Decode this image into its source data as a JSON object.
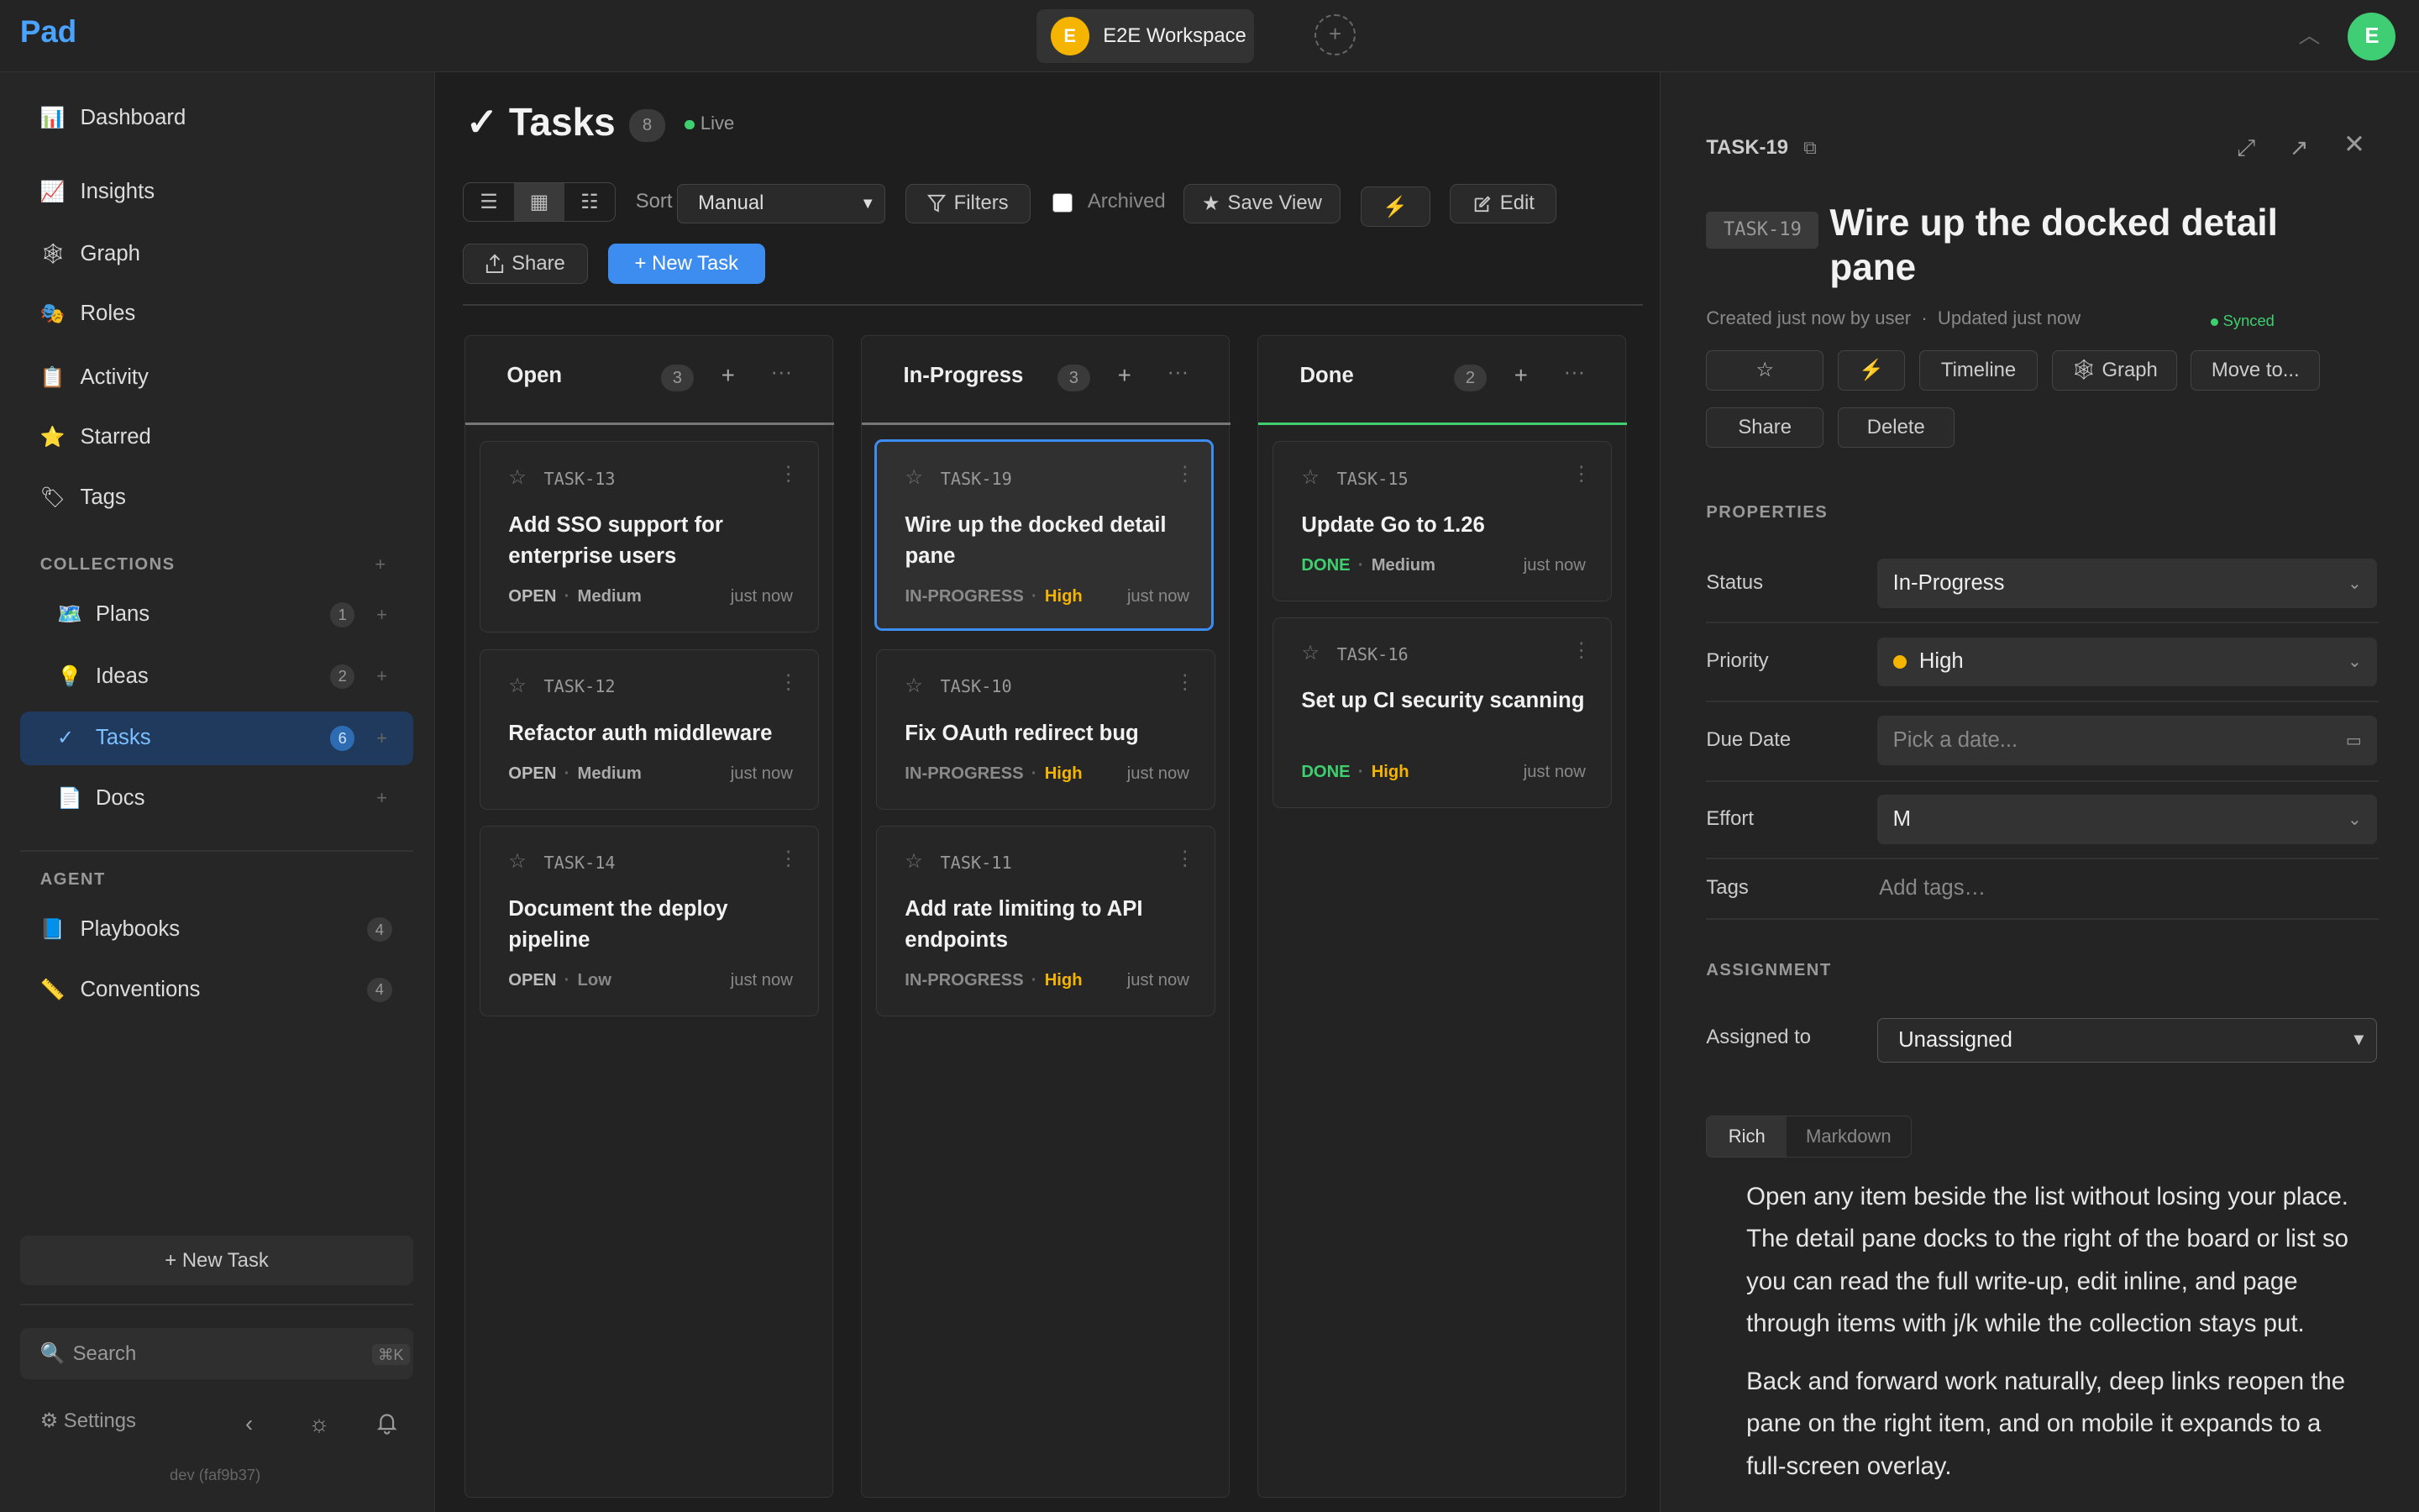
{
  "app": {
    "logo": "Pad"
  },
  "workspace": {
    "initial": "E",
    "name": "E2E Workspace",
    "add": "+"
  },
  "user": {
    "initial": "E"
  },
  "sidebar": {
    "nav": [
      {
        "icon": "📊",
        "label": "Dashboard"
      },
      {
        "icon": "📈",
        "label": "Insights"
      },
      {
        "icon": "🕸",
        "label": "Graph"
      },
      {
        "icon": "🎭",
        "label": "Roles"
      },
      {
        "icon": "📋",
        "label": "Activity"
      },
      {
        "icon": "⭐",
        "label": "Starred"
      },
      {
        "icon": "🏷",
        "label": "Tags"
      }
    ],
    "collections_heading": "COLLECTIONS",
    "collections": [
      {
        "icon": "🗺️",
        "label": "Plans",
        "count": "1"
      },
      {
        "icon": "💡",
        "label": "Ideas",
        "count": "2"
      },
      {
        "icon": "✓",
        "label": "Tasks",
        "count": "6"
      },
      {
        "icon": "📄",
        "label": "Docs",
        "count": ""
      }
    ],
    "agent_heading": "AGENT",
    "agent": [
      {
        "icon": "📘",
        "label": "Playbooks",
        "count": "4"
      },
      {
        "icon": "📏",
        "label": "Conventions",
        "count": "4"
      }
    ],
    "new_task": "+ New Task",
    "search_placeholder": "Search",
    "search_shortcut": "⌘K",
    "settings": "Settings",
    "version": "dev (faf9b37)"
  },
  "main": {
    "title": "Tasks",
    "title_icon": "✓",
    "count": "8",
    "live": "Live",
    "sort_label": "Sort",
    "sort_value": "Manual",
    "filters": "Filters",
    "archived": "Archived",
    "save_view": "Save View",
    "edit": "Edit",
    "share": "Share",
    "new_task": "+ New Task"
  },
  "board": {
    "columns": [
      {
        "title": "Open",
        "count": "3",
        "accent": "#777777",
        "cards": [
          {
            "id": "TASK-13",
            "title": "Add SSO support for enterprise users",
            "status": "OPEN",
            "priority": "Medium",
            "time": "just now"
          },
          {
            "id": "TASK-12",
            "title": "Refactor auth middleware",
            "status": "OPEN",
            "priority": "Medium",
            "time": "just now"
          },
          {
            "id": "TASK-14",
            "title": "Document the deploy pipeline",
            "status": "OPEN",
            "priority": "Low",
            "time": "just now"
          }
        ]
      },
      {
        "title": "In-Progress",
        "count": "3",
        "accent": "#777777",
        "cards": [
          {
            "id": "TASK-19",
            "title": "Wire up the docked detail pane",
            "status": "IN-PROGRESS",
            "priority": "High",
            "time": "just now"
          },
          {
            "id": "TASK-10",
            "title": "Fix OAuth redirect bug",
            "status": "IN-PROGRESS",
            "priority": "High",
            "time": "just now"
          },
          {
            "id": "TASK-11",
            "title": "Add rate limiting to API endpoints",
            "status": "IN-PROGRESS",
            "priority": "High",
            "time": "just now"
          }
        ]
      },
      {
        "title": "Done",
        "count": "2",
        "accent": "#3ecf6e",
        "cards": [
          {
            "id": "TASK-15",
            "title": "Update Go to 1.26",
            "status": "DONE",
            "priority": "Medium",
            "time": "just now"
          },
          {
            "id": "TASK-16",
            "title": "Set up CI security scanning",
            "status": "DONE",
            "priority": "High",
            "time": "just now"
          }
        ]
      }
    ]
  },
  "detail": {
    "id": "TASK-19",
    "badge": "TASK-19",
    "title": "Wire up the docked detail pane",
    "created": "Created just now by user",
    "updated": "Updated just now",
    "synced": "Synced",
    "actions": {
      "star": "☆",
      "bolt": "⚡",
      "timeline": "Timeline",
      "graph": "🕸 Graph",
      "move": "Move to...",
      "share": "Share",
      "delete": "Delete"
    },
    "properties_heading": "PROPERTIES",
    "status_label": "Status",
    "status_value": "In-Progress",
    "priority_label": "Priority",
    "priority_value": "High",
    "due_label": "Due Date",
    "due_placeholder": "Pick a date...",
    "effort_label": "Effort",
    "effort_value": "M",
    "tags_label": "Tags",
    "tags_placeholder": "Add tags…",
    "assignment_heading": "ASSIGNMENT",
    "assigned_label": "Assigned to",
    "assigned_value": "Unassigned",
    "tab_rich": "Rich",
    "tab_markdown": "Markdown",
    "body": [
      "Open any item beside the list without losing your place. The detail pane docks to the right of the board or list so you can read the full write-up, edit inline, and page through items with j/k while the collection stays put.",
      "Back and forward work naturally, deep links reopen the pane on the right item, and on mobile it expands to a full-screen overlay."
    ]
  },
  "colors": {
    "accent": "#3d8df0",
    "high": "#f5b400",
    "done": "#3ecf6e"
  }
}
